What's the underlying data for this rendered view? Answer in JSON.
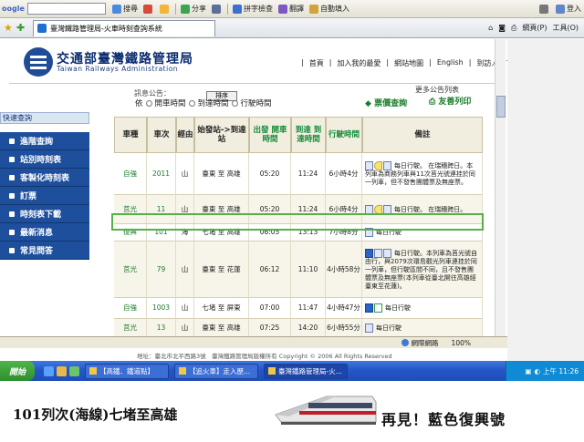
{
  "toolbar": {
    "logo": "oogle",
    "search": "搜尋",
    "share": "分享",
    "spell": "拼字檢查",
    "translate": "翻譯",
    "auto_fill": "自動填入",
    "login": "登入"
  },
  "browser": {
    "tab_title": "臺灣鐵路管理局-火車時刻查詢系統",
    "page_menu": "網頁(P)",
    "tools_menu": "工具(O)"
  },
  "header": {
    "org_cn": "交通部臺灣鐵路管理局",
    "org_en": "Taiwan Railways Administration",
    "links": [
      "首頁",
      "加入我的最愛",
      "網站地圖",
      "English",
      "到訪人數788673"
    ]
  },
  "announce": {
    "label": "訊息公告：",
    "more": "更多公告列表",
    "ticket_query": "票價查詢",
    "print": "友善列印",
    "sort_label": "依",
    "sort_options": [
      "開車時間",
      "到達時間",
      "行駛時間"
    ],
    "sort_button": "排序"
  },
  "sidebar": {
    "title": "快速查詢",
    "items": [
      "進階查詢",
      "站別時刻表",
      "客製化時刻表",
      "訂票",
      "時刻表下載",
      "最新消息",
      "常見問答"
    ]
  },
  "table": {
    "headers": [
      "車種",
      "車次",
      "經由",
      "始發站->到達站",
      "出發 開車時間",
      "到達 到達時間",
      "行駛時間",
      "備註"
    ],
    "rows": [
      {
        "type": "自強",
        "no": "2011",
        "via": "山",
        "route": "臺東 至 高雄",
        "dep": "05:20",
        "arr": "11:24",
        "dur": "6小時4分",
        "note": "每日行駛。 在瑞穗跨日。本列車為商務列車與11次莒光號連挂於同一列車，但不發售團體票及無座票。"
      },
      {
        "type": "莒光",
        "no": "11",
        "via": "山",
        "route": "臺東 至 高雄",
        "dep": "05:20",
        "arr": "11:24",
        "dur": "6小時4分",
        "note": "每日行駛。 在瑞穗跨日。"
      },
      {
        "type": "復興",
        "no": "101",
        "via": "海",
        "route": "七堵 至 高雄",
        "dep": "06:05",
        "arr": "13:13",
        "dur": "7小時8分",
        "note": "每日行駛"
      },
      {
        "type": "莒光",
        "no": "79",
        "via": "山",
        "route": "臺東 至 花蓮",
        "dep": "06:12",
        "arr": "11:10",
        "dur": "4小時58分",
        "note": "每日行駛。本列車為莒光號自由行，與2079次環島觀光列車連挂於同一列車，但行駛區間不同，且不發售團體票及無座票(本列車從臺北開往高雄經臺東至花蓮)。"
      },
      {
        "type": "自強",
        "no": "1003",
        "via": "山",
        "route": "七堵 至 屏東",
        "dep": "07:00",
        "arr": "11:47",
        "dur": "4小時47分",
        "note": "每日行駛"
      },
      {
        "type": "莒光",
        "no": "13",
        "via": "山",
        "route": "臺東 至 高雄",
        "dep": "07:25",
        "arr": "14:20",
        "dur": "6小時55分",
        "note": "每日行駛"
      }
    ]
  },
  "footer": {
    "copyright": "地址：臺北市北平西路3號　臺灣鐵路管理局版權所有 Copyright © 2006 All Rights Reserved"
  },
  "statusbar": {
    "zone": "網際網路",
    "zoom": "100%"
  },
  "taskbar": {
    "start": "開始",
    "tasks": [
      "【高鐵．鐵道點】",
      "【追火車】走入歷...",
      "臺灣鐵路管理局-火..."
    ],
    "clock": "上午 11:26"
  },
  "caption": {
    "left": "101列次(海線)七堵至高雄",
    "right": "再見！藍色復興號"
  },
  "colors": {
    "sidebar_blue": "#1d4f9d",
    "highlight_green": "#55b04a",
    "type_green": "#1d7a2c"
  }
}
